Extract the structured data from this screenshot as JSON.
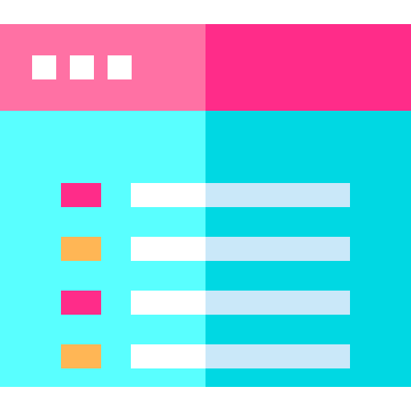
{
  "colors": {
    "titlebar_left": "#ff71a4",
    "titlebar_right": "#ff2c89",
    "body_left": "#59ffff",
    "body_right": "#00d8e3",
    "window_dot": "#ffffff",
    "line_left": "#ffffff",
    "line_right": "#cae8f9"
  },
  "title_dots": [
    {
      "icon": "window-control-dot-icon"
    },
    {
      "icon": "window-control-dot-icon"
    },
    {
      "icon": "window-control-dot-icon"
    }
  ],
  "list_rows": [
    {
      "bullet_color": "#ff2c89"
    },
    {
      "bullet_color": "#ffb655"
    },
    {
      "bullet_color": "#ff2c89"
    },
    {
      "bullet_color": "#ffb655"
    }
  ]
}
